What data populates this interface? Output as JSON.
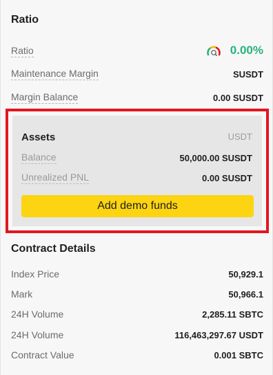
{
  "ratio_section": {
    "title": "Ratio",
    "rows": [
      {
        "label": "Ratio",
        "value": "0.00%"
      },
      {
        "label": "Maintenance Margin",
        "value": "SUSDT"
      },
      {
        "label": "Margin Balance",
        "value": "0.00 SUSDT"
      }
    ],
    "gauge_icon": "gauge-icon",
    "ratio_color": "#27b37a"
  },
  "assets": {
    "title": "Assets",
    "currency": "USDT",
    "rows": [
      {
        "label": "Balance",
        "value": "50,000.00 SUSDT"
      },
      {
        "label": "Unrealized PNL",
        "value": "0.00 SUSDT"
      }
    ],
    "button_label": "Add demo funds",
    "highlight_color": "#e3161e",
    "button_color": "#fcd411"
  },
  "contract_details": {
    "title": "Contract Details",
    "rows": [
      {
        "label": "Index Price",
        "value": "50,929.1"
      },
      {
        "label": "Mark",
        "value": "50,966.1"
      },
      {
        "label": "24H Volume",
        "value": "2,285.11 SBTC"
      },
      {
        "label": "24H Volume",
        "value": "116,463,297.67 USDT"
      },
      {
        "label": "Contract Value",
        "value": "0.001 SBTC"
      }
    ]
  }
}
